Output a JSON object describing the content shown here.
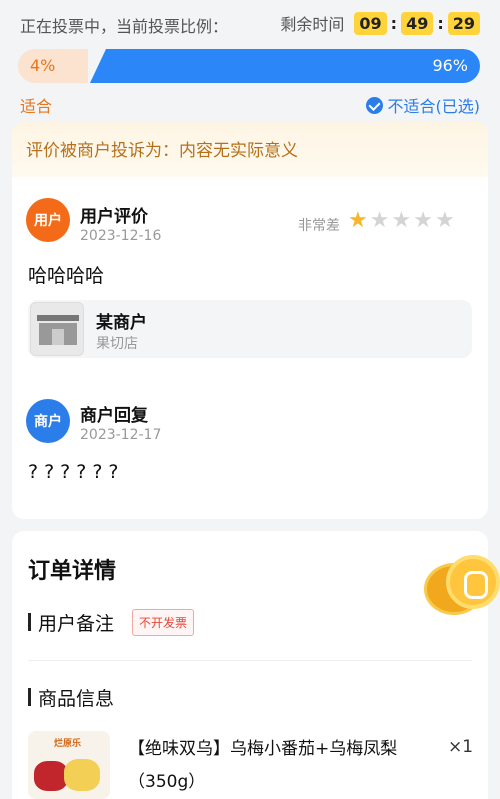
{
  "vote": {
    "status_text": "正在投票中，当前投票比例：",
    "timer_label": "剩余时间",
    "timer": {
      "hours": "09",
      "minutes": "49",
      "seconds": "29"
    },
    "left_percent_label": "4%",
    "right_percent_label": "96%",
    "left_fraction": 0.04,
    "right_fraction": 0.96,
    "option_left": "适合",
    "option_right": "不适合(已选)",
    "colors": {
      "accent_orange": "#e8761e",
      "accent_blue": "#2b86f7"
    }
  },
  "complaint": {
    "text": "评价被商户投诉为：内容无实际意义"
  },
  "user_review": {
    "avatar_label": "用户",
    "title": "用户评价",
    "date": "2023-12-16",
    "rating_label": "非常差",
    "rating": 1,
    "rating_max": 5,
    "text": "哈哈哈哈"
  },
  "shop": {
    "name": "某商户",
    "category": "果切店",
    "icon": "storefront-icon"
  },
  "merchant_reply": {
    "avatar_label": "商户",
    "title": "商户回复",
    "date": "2023-12-17",
    "text": "??????"
  },
  "order": {
    "title": "订单详情",
    "remark_title": "用户备注",
    "remark_tag": "不开发票",
    "goods_title": "商品信息",
    "product": {
      "brand": "烂原乐",
      "name": "【绝味双乌】乌梅小番茄+乌梅凤梨（350g）",
      "quantity": "×1"
    }
  }
}
